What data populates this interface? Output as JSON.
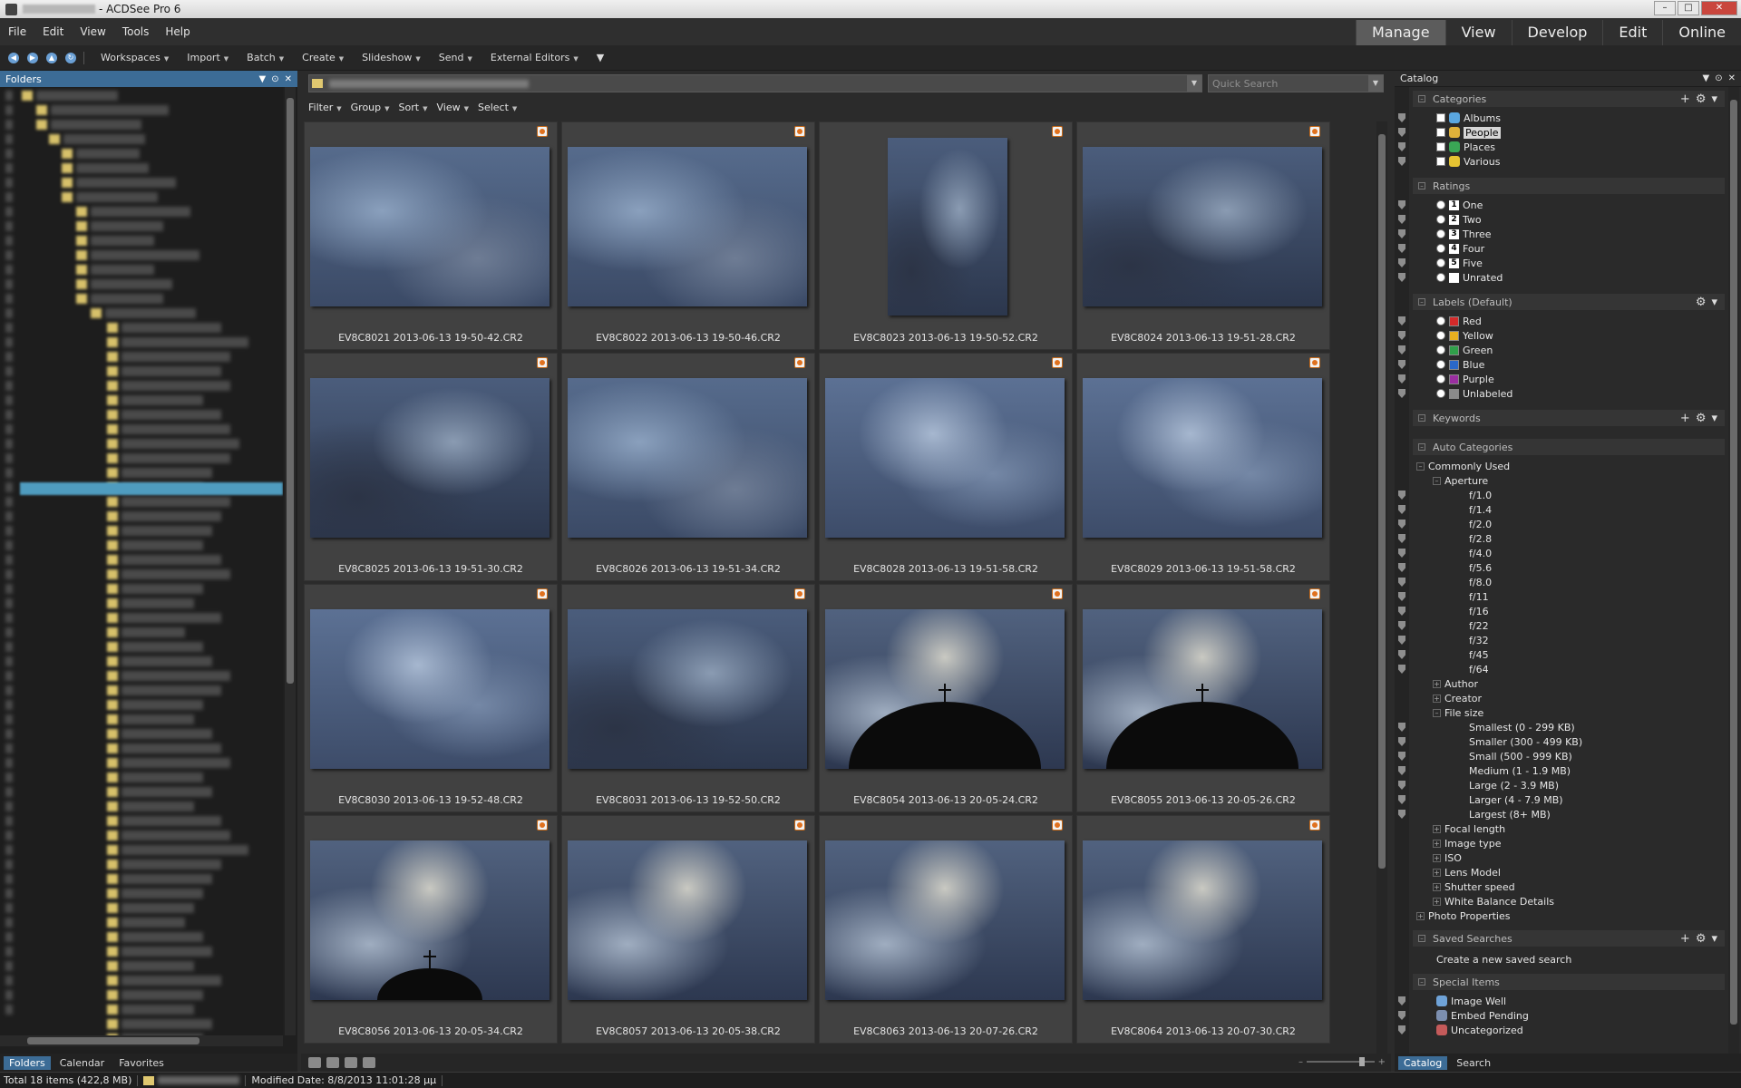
{
  "window": {
    "title": "- ACDSee Pro 6"
  },
  "menu": [
    "File",
    "Edit",
    "View",
    "Tools",
    "Help"
  ],
  "modes": [
    {
      "label": "Manage",
      "active": true
    },
    {
      "label": "View",
      "active": false
    },
    {
      "label": "Develop",
      "active": false
    },
    {
      "label": "Edit",
      "active": false
    },
    {
      "label": "Online",
      "active": false
    }
  ],
  "toolbar": [
    "Workspaces",
    "Import",
    "Batch",
    "Create",
    "Slideshow",
    "Send",
    "External Editors"
  ],
  "left_panel": {
    "title": "Folders",
    "tabs": [
      "Folders",
      "Calendar",
      "Favorites"
    ]
  },
  "center": {
    "search_placeholder": "Quick Search",
    "filterbar": [
      "Filter",
      "Group",
      "Sort",
      "View",
      "Select"
    ],
    "items": [
      {
        "name": "EV8C8021 2013-06-13 19-50-42.CR2",
        "sky": "sky1",
        "portrait": false,
        "dome": "none"
      },
      {
        "name": "EV8C8022 2013-06-13 19-50-46.CR2",
        "sky": "sky1",
        "portrait": false,
        "dome": "none"
      },
      {
        "name": "EV8C8023 2013-06-13 19-50-52.CR2",
        "sky": "sky2",
        "portrait": true,
        "dome": "none"
      },
      {
        "name": "EV8C8024 2013-06-13 19-51-28.CR2",
        "sky": "sky2",
        "portrait": false,
        "dome": "none"
      },
      {
        "name": "EV8C8025 2013-06-13 19-51-30.CR2",
        "sky": "sky2",
        "portrait": false,
        "dome": "none"
      },
      {
        "name": "EV8C8026 2013-06-13 19-51-34.CR2",
        "sky": "sky1",
        "portrait": false,
        "dome": "none"
      },
      {
        "name": "EV8C8028 2013-06-13 19-51-58.CR2",
        "sky": "sky3",
        "portrait": false,
        "dome": "none"
      },
      {
        "name": "EV8C8029 2013-06-13 19-51-58.CR2",
        "sky": "sky3",
        "portrait": false,
        "dome": "none"
      },
      {
        "name": "EV8C8030 2013-06-13 19-52-48.CR2",
        "sky": "sky3",
        "portrait": false,
        "dome": "none"
      },
      {
        "name": "EV8C8031 2013-06-13 19-52-50.CR2",
        "sky": "sky2",
        "portrait": false,
        "dome": "none"
      },
      {
        "name": "EV8C8054 2013-06-13 20-05-24.CR2",
        "sky": "sky4",
        "portrait": false,
        "dome": "large"
      },
      {
        "name": "EV8C8055 2013-06-13 20-05-26.CR2",
        "sky": "sky4",
        "portrait": false,
        "dome": "large"
      },
      {
        "name": "EV8C8056 2013-06-13 20-05-34.CR2",
        "sky": "sky4",
        "portrait": false,
        "dome": "small"
      },
      {
        "name": "EV8C8057 2013-06-13 20-05-38.CR2",
        "sky": "sky4",
        "portrait": false,
        "dome": "none"
      },
      {
        "name": "EV8C8063 2013-06-13 20-07-26.CR2",
        "sky": "sky4",
        "portrait": false,
        "dome": "none"
      },
      {
        "name": "EV8C8064 2013-06-13 20-07-30.CR2",
        "sky": "sky4",
        "portrait": false,
        "dome": "none"
      }
    ]
  },
  "catalog": {
    "title": "Catalog",
    "sections": {
      "categories": "Categories",
      "ratings": "Ratings",
      "labels": "Labels (Default)",
      "keywords": "Keywords",
      "auto": "Auto Categories",
      "saved": "Saved Searches",
      "special": "Special Items"
    },
    "categories": [
      {
        "label": "Albums",
        "color": "#5aa7e0"
      },
      {
        "label": "People",
        "color": "#e0b23a"
      },
      {
        "label": "Places",
        "color": "#3aa655"
      },
      {
        "label": "Various",
        "color": "#e5c332"
      }
    ],
    "ratings": [
      {
        "num": "1",
        "label": "One"
      },
      {
        "num": "2",
        "label": "Two"
      },
      {
        "num": "3",
        "label": "Three"
      },
      {
        "num": "4",
        "label": "Four"
      },
      {
        "num": "5",
        "label": "Five"
      },
      {
        "num": "",
        "label": "Unrated"
      }
    ],
    "labels": [
      {
        "label": "Red",
        "color": "#d42a2a"
      },
      {
        "label": "Yellow",
        "color": "#e8b020"
      },
      {
        "label": "Green",
        "color": "#30a04a"
      },
      {
        "label": "Blue",
        "color": "#2a68c8"
      },
      {
        "label": "Purple",
        "color": "#9a2ea0"
      },
      {
        "label": "Unlabeled",
        "color": "#8a8a8a"
      }
    ],
    "auto_common": "Commonly Used",
    "aperture": "Aperture",
    "apertures": [
      "f/1.0",
      "f/1.4",
      "f/2.0",
      "f/2.8",
      "f/4.0",
      "f/5.6",
      "f/8.0",
      "f/11",
      "f/16",
      "f/22",
      "f/32",
      "f/45",
      "f/64"
    ],
    "author": "Author",
    "creator": "Creator",
    "filesize": "File size",
    "filesizes": [
      "Smallest (0 - 299 KB)",
      "Smaller (300 - 499 KB)",
      "Small (500 - 999 KB)",
      "Medium (1 - 1.9 MB)",
      "Large (2 - 3.9 MB)",
      "Larger (4 - 7.9 MB)",
      "Largest (8+ MB)"
    ],
    "more_auto": [
      "Focal length",
      "Image type",
      "ISO",
      "Lens Model",
      "Shutter speed",
      "White Balance Details"
    ],
    "photo_properties": "Photo Properties",
    "create_saved": "Create a new saved search",
    "special_items": [
      "Image Well",
      "Embed Pending",
      "Uncategorized"
    ],
    "tabs": [
      "Catalog",
      "Search"
    ]
  },
  "status": {
    "total": "Total 18 items  (422,8 MB)",
    "modified": "Modified Date: 8/8/2013 11:01:28 μμ"
  }
}
